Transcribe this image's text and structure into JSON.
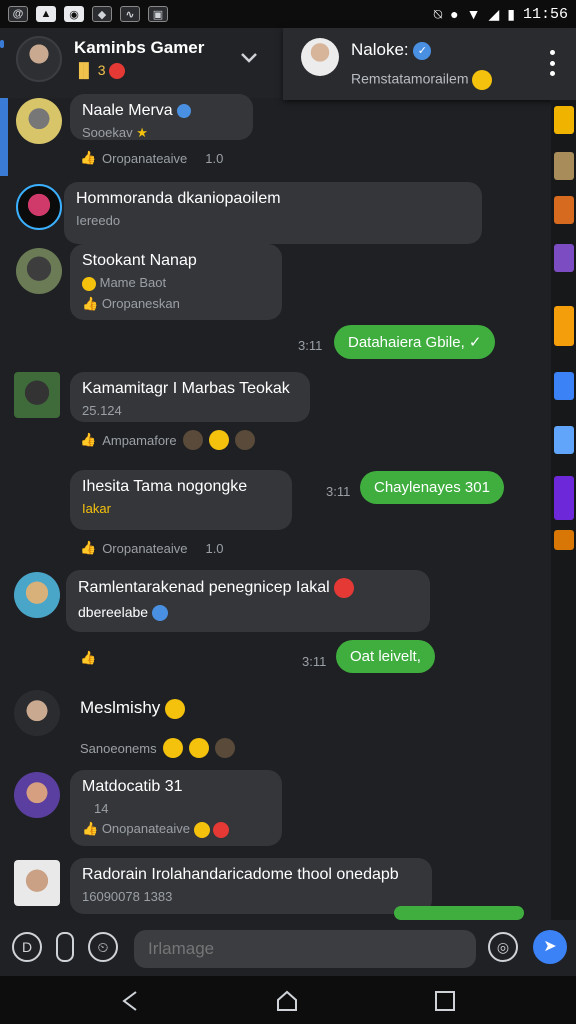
{
  "status_bar": {
    "time": "11:56"
  },
  "header": {
    "title": "Kaminbs Gamer",
    "subtitle": "3"
  },
  "popup": {
    "title": "Naloke:",
    "subtitle": "Remstatamorailem"
  },
  "messages": [
    {
      "name": "Naale Merva",
      "sub": "Sooekav",
      "meta": "Oropanateaive",
      "time": "1.0"
    },
    {
      "name": "Hommoranda dkaniopaoilem",
      "sub": "Iereedo"
    },
    {
      "name": "Stookant Nanap",
      "sub": "Mame Baot",
      "meta": "Oropaneskan"
    },
    {
      "out_text": "Datahaiera Gbile,",
      "out_time": "3:11"
    },
    {
      "name": "Kamamitagr I Marbas Teokak",
      "sub": "25.124",
      "meta": "Ampamafore"
    },
    {
      "name": "Ihesita Tama nogongke",
      "sub": "Iakar",
      "meta": "Oropanateaive",
      "time": "1.0"
    },
    {
      "out_text": "Chaylenayes 301",
      "out_time": "3:11"
    },
    {
      "name": "Ramlentarakenad penegnicep Iakal",
      "sub": "dbereelabe"
    },
    {
      "out_text": "Oat leivelt,",
      "out_time": "3:11"
    },
    {
      "name": "Meslmishy",
      "meta": "Sanoeonems"
    },
    {
      "name": "Matdocatib 31",
      "sub": "14",
      "meta": "Onopanateaive"
    },
    {
      "name": "Radorain Irolahandaricadome thool onedapb",
      "sub": "16090078 1383"
    }
  ],
  "composer": {
    "placeholder": "Irlamage"
  },
  "icons": {
    "back": "back-triangle-icon",
    "home": "home-icon",
    "recent": "recent-apps-icon"
  }
}
